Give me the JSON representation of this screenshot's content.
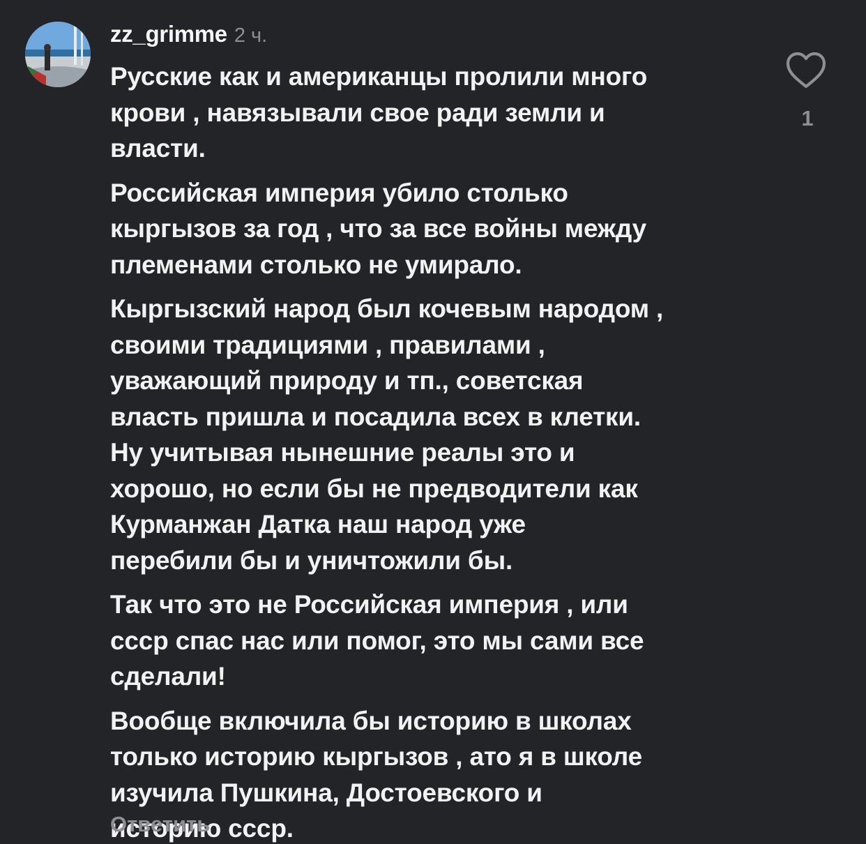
{
  "comment": {
    "username": "zz_grimme",
    "time": "2 ч.",
    "paragraphs": [
      [
        "Русские как и американцы пролили много",
        "крови , навязывали свое ради земли и",
        "власти."
      ],
      [
        "Российская империя убило столько",
        "кыргызов за год , что за все войны между",
        "племенами столько не умирало."
      ],
      [
        "Кыргызский народ был кочевым народом ,",
        "своими традициями , правилами ,",
        "уважающий природу и тп., советская",
        "власть пришла и посадила всех в клетки.",
        "Ну учитывая нынешние реалы это и",
        "хорошо, но если бы не предводители как",
        "Курманжан Датка наш народ уже",
        "перебили бы и уничтожили бы."
      ],
      [
        "Так что это не Российская империя , или",
        "ссср спас нас или помог, это мы сами все",
        "сделали!"
      ],
      [
        "Вообще включила бы историю в школах",
        "только историю кыргызов , ато я в школе",
        "изучила Пушкина, Достоевского и",
        "историю ссср."
      ]
    ],
    "reply_label": "Ответить",
    "like_count": "1",
    "like_icon": "heart-outline-icon",
    "avatar_icon": "profile-photo"
  },
  "colors": {
    "background": "#232428",
    "text": "#f2f2f2",
    "muted": "#8e8e93"
  }
}
